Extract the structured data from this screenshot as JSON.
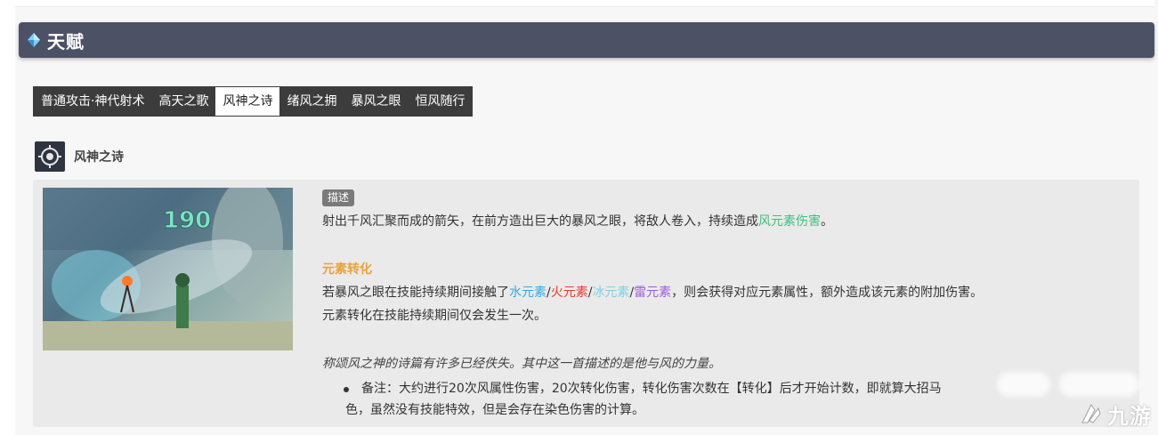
{
  "section": {
    "title": "天赋"
  },
  "tabs": [
    {
      "label": "普通攻击·神代射术",
      "active": false
    },
    {
      "label": "高天之歌",
      "active": false
    },
    {
      "label": "风神之诗",
      "active": true
    },
    {
      "label": "绪风之拥",
      "active": false
    },
    {
      "label": "暴风之眼",
      "active": false
    },
    {
      "label": "恒风随行",
      "active": false
    }
  ],
  "skill": {
    "name": "风神之诗",
    "icon": "target-icon",
    "video": {
      "damage_number": "190"
    }
  },
  "description": {
    "tag": "描述",
    "line1_pre": "射出千风汇聚而成的箭矢，在前方造出巨大的暴风之眼，将敌人卷入，持续造成",
    "line1_highlight": "风元素伤害",
    "line1_post": "。",
    "conversion_title": "元素转化",
    "line2_pre": "若暴风之眼在技能持续期间接触了",
    "element_hydro": "水元素",
    "element_pyro": "火元素",
    "element_cryo": "冰元素",
    "element_electro": "雷元素",
    "slash": "/",
    "line2_post": "，则会获得对应元素属性，额外造成该元素的附加伤害。",
    "line3": "元素转化在技能持续期间仅会发生一次。",
    "flavor": "称颂风之神的诗篇有许多已经佚失。其中这一首描述的是他与风的力量。",
    "note_line1": "备注：大约进行20次风属性伤害，20次转化伤害，转化伤害次数在【转化】后才开始计数，即就算大招马",
    "note_line2": "色，虽然没有技能特效，但是会存在染色伤害的计算。"
  },
  "watermark": {
    "text": "九游"
  },
  "colors": {
    "header_bg": "#4d5166",
    "tab_bg": "#3c3c3c",
    "anemo": "#3fbf7f",
    "hydro": "#33a9e6",
    "pyro": "#e63c2c",
    "cryo": "#80cfe6",
    "electro": "#a05cd9",
    "conversion": "#e8a33c"
  }
}
